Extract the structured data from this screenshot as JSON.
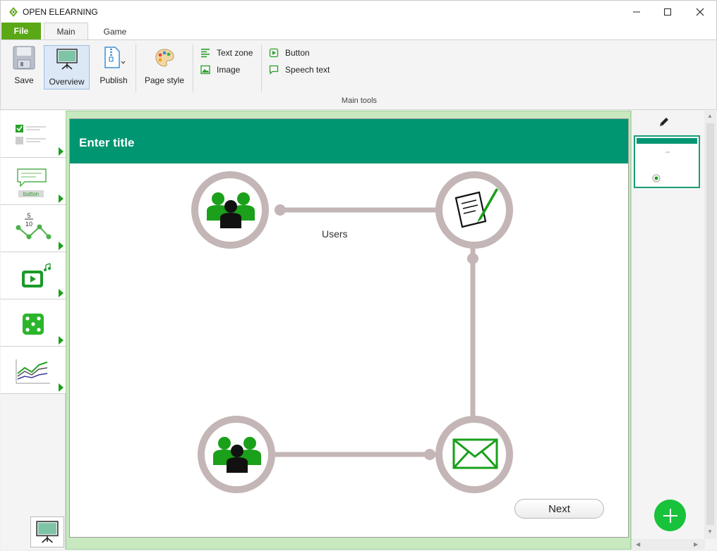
{
  "window": {
    "title": "OPEN ELEARNING",
    "controls": [
      "minimize-icon",
      "maximize-icon",
      "close-icon"
    ]
  },
  "tabs": {
    "file": "File",
    "main": "Main",
    "game": "Game"
  },
  "ribbon": {
    "save": "Save",
    "overview": "Overview",
    "publish": "Publish",
    "page_style": "Page style",
    "text_zone": "Text zone",
    "image": "Image",
    "button": "Button",
    "speech_text": "Speech text",
    "group_label": "Main tools"
  },
  "sidebar": {
    "items": [
      {
        "icon": "checklist-icon"
      },
      {
        "icon": "speech-button-icon",
        "caption": "button"
      },
      {
        "icon": "fraction-graph-icon",
        "top": "5",
        "bottom": "10"
      },
      {
        "icon": "video-music-icon"
      },
      {
        "icon": "dice-icon"
      },
      {
        "icon": "line-chart-icon"
      }
    ]
  },
  "slide": {
    "title": "Enter title",
    "users_label": "Users",
    "next_button": "Next"
  },
  "colors": {
    "accent": "#009672",
    "file_tab": "#5aa816",
    "node_ring": "#c4b6b6",
    "icon_green": "#1aa01a",
    "add_button": "#18c23a"
  }
}
